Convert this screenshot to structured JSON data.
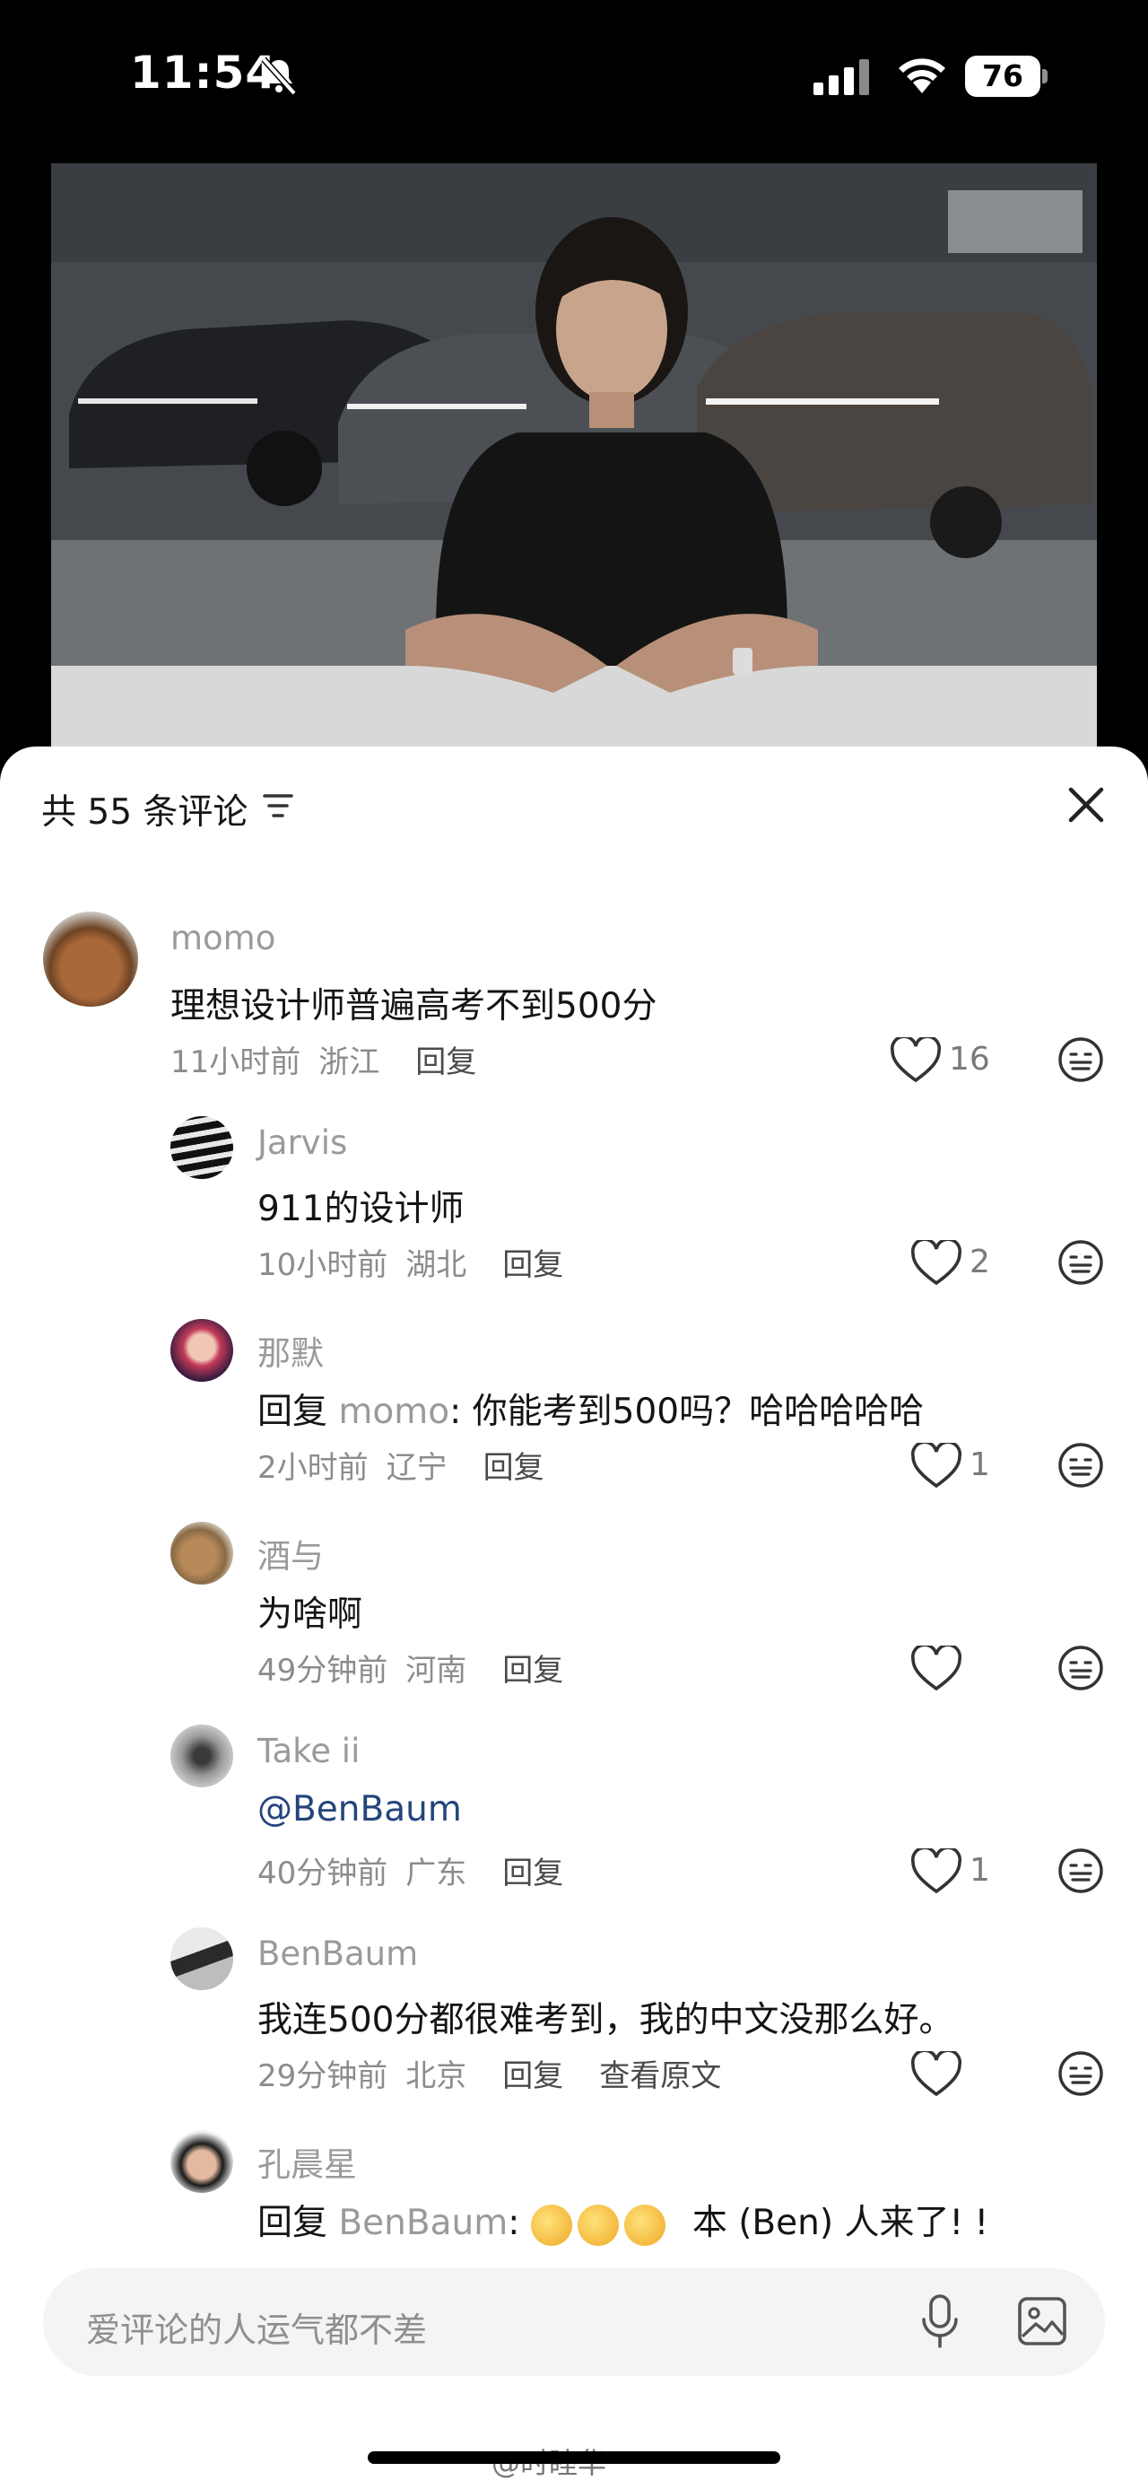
{
  "status_bar": {
    "time": "11:54",
    "battery": "76"
  },
  "video": {
    "description_icon": "video-thumbnail"
  },
  "comments_panel": {
    "title": "共 55 条评论",
    "input_placeholder": "爱评论的人运气都不差"
  },
  "comments": [
    {
      "user": "momo",
      "text": "理想设计师普遍高考不到500分",
      "time": "11小时前",
      "location": "浙江",
      "reply_label": "回复",
      "likes": "16"
    },
    {
      "user": "Jarvis",
      "text": "911的设计师",
      "time": "10小时前",
      "location": "湖北",
      "reply_label": "回复",
      "likes": "2"
    },
    {
      "user": "那默",
      "reply_prefix": "回复",
      "reply_to": "momo",
      "text": ": 你能考到500吗？哈哈哈哈哈",
      "time": "2小时前",
      "location": "辽宁",
      "reply_label": "回复",
      "likes": "1"
    },
    {
      "user": "酒与",
      "text": "为啥啊",
      "time": "49分钟前",
      "location": "河南",
      "reply_label": "回复",
      "likes": ""
    },
    {
      "user": "Take ii",
      "text": "@BenBaum",
      "time": "40分钟前",
      "location": "广东",
      "reply_label": "回复",
      "likes": "1"
    },
    {
      "user": "BenBaum",
      "text": "我连500分都很难考到，我的中文没那么好。",
      "time": "29分钟前",
      "location": "北京",
      "reply_label": "回复",
      "extra_action": "查看原文",
      "likes": ""
    },
    {
      "user": "孔晨星",
      "reply_prefix": "回复",
      "reply_to": "BenBaum",
      "text": "本 (Ben) 人来了! !",
      "time": "",
      "location": ""
    }
  ],
  "watermark": "@时睦华",
  "colors": {
    "mention": "#24457c",
    "muted": "#9a9a9a",
    "sheet_bg": "#ffffff"
  }
}
